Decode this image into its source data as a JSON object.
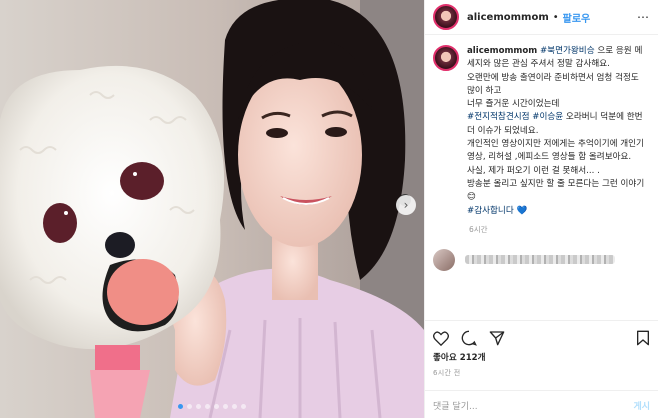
{
  "header": {
    "username": "alicemommom",
    "separator": "•",
    "follow_label": "팔로우",
    "more_icon": "ellipsis-icon"
  },
  "caption": {
    "username": "alicemommom",
    "line1_tag": "#북면가왕비승",
    "line1_rest": " 으로 응원 메세지와 많은 관심 주셔서 정말 감사해요.",
    "line2": "오랜만에 방송 출연이라 준비하면서 엄청 걱정도 많이 하고",
    "line3": "너무 즐거운 시간이었는데",
    "tag2": "#전지적참견시점",
    "tag3": "#이승윤",
    "line4_rest": " 오라버니 덕분에 한번 더 이슈가 되었네요.",
    "line5": "개인적인 영상이지만 저에게는 추억이기에 개인기 영상, 리허설 ,에피소드 영상들 함 올려보아요.",
    "line6": "사실, 제가 퍼오기 이런 걸 못해서... .",
    "line7": "방송분 올리고 싶지만 할 줄 모른다는 그런 이야기 😊",
    "tag4": "#감사합니다",
    "heart": "💙"
  },
  "time_ago": "6시간",
  "actions": {
    "like_icon": "heart-icon",
    "comment_icon": "comment-icon",
    "share_icon": "share-icon",
    "save_icon": "bookmark-icon"
  },
  "likes_text": "좋아요 212개",
  "date_text": "6시간 전",
  "add_comment": {
    "placeholder": "댓글 달기...",
    "post_label": "게시"
  },
  "carousel": {
    "slide_count": 8,
    "active_index": 1,
    "next_icon": "chevron-right-icon"
  },
  "colors": {
    "link": "#003569",
    "follow": "#3897f0",
    "active_dot": "#3897f0"
  }
}
